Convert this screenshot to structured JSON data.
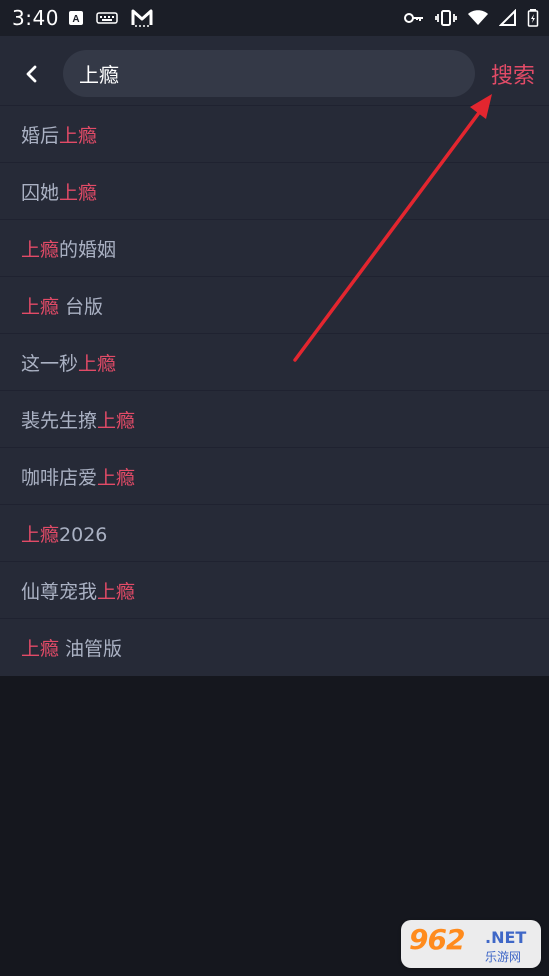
{
  "status_bar": {
    "time": "3:40"
  },
  "search": {
    "query": "上瘾",
    "button_label": "搜索"
  },
  "suggestions": [
    {
      "before": "婚后",
      "highlight": "上瘾",
      "after": ""
    },
    {
      "before": "囚她",
      "highlight": "上瘾",
      "after": ""
    },
    {
      "before": "",
      "highlight": "上瘾",
      "after": "的婚姻"
    },
    {
      "before": "",
      "highlight": "上瘾",
      "after": " 台版"
    },
    {
      "before": "这一秒",
      "highlight": "上瘾",
      "after": ""
    },
    {
      "before": "裴先生撩",
      "highlight": "上瘾",
      "after": ""
    },
    {
      "before": "咖啡店爱",
      "highlight": "上瘾",
      "after": ""
    },
    {
      "before": "",
      "highlight": "上瘾",
      "after": "2026"
    },
    {
      "before": "仙尊宠我",
      "highlight": "上瘾",
      "after": ""
    },
    {
      "before": "",
      "highlight": "上瘾",
      "after": " 油管版"
    }
  ],
  "watermark": {
    "logo": "962",
    "suffix": ".NET",
    "site": "乐游网"
  },
  "icons": {
    "back": "chevron-left-icon",
    "app_a": "a-icon",
    "keyboard": "keyboard-icon",
    "mail": "m-icon",
    "vpn": "key-icon",
    "vibrate": "vibrate-icon",
    "wifi": "wifi-icon",
    "signal": "signal-icon",
    "battery": "battery-icon"
  },
  "colors": {
    "background": "#15171e",
    "panel": "#262a37",
    "search_bg": "#343947",
    "accent": "#e24b67",
    "suggestion_text": "#aab1c3"
  }
}
